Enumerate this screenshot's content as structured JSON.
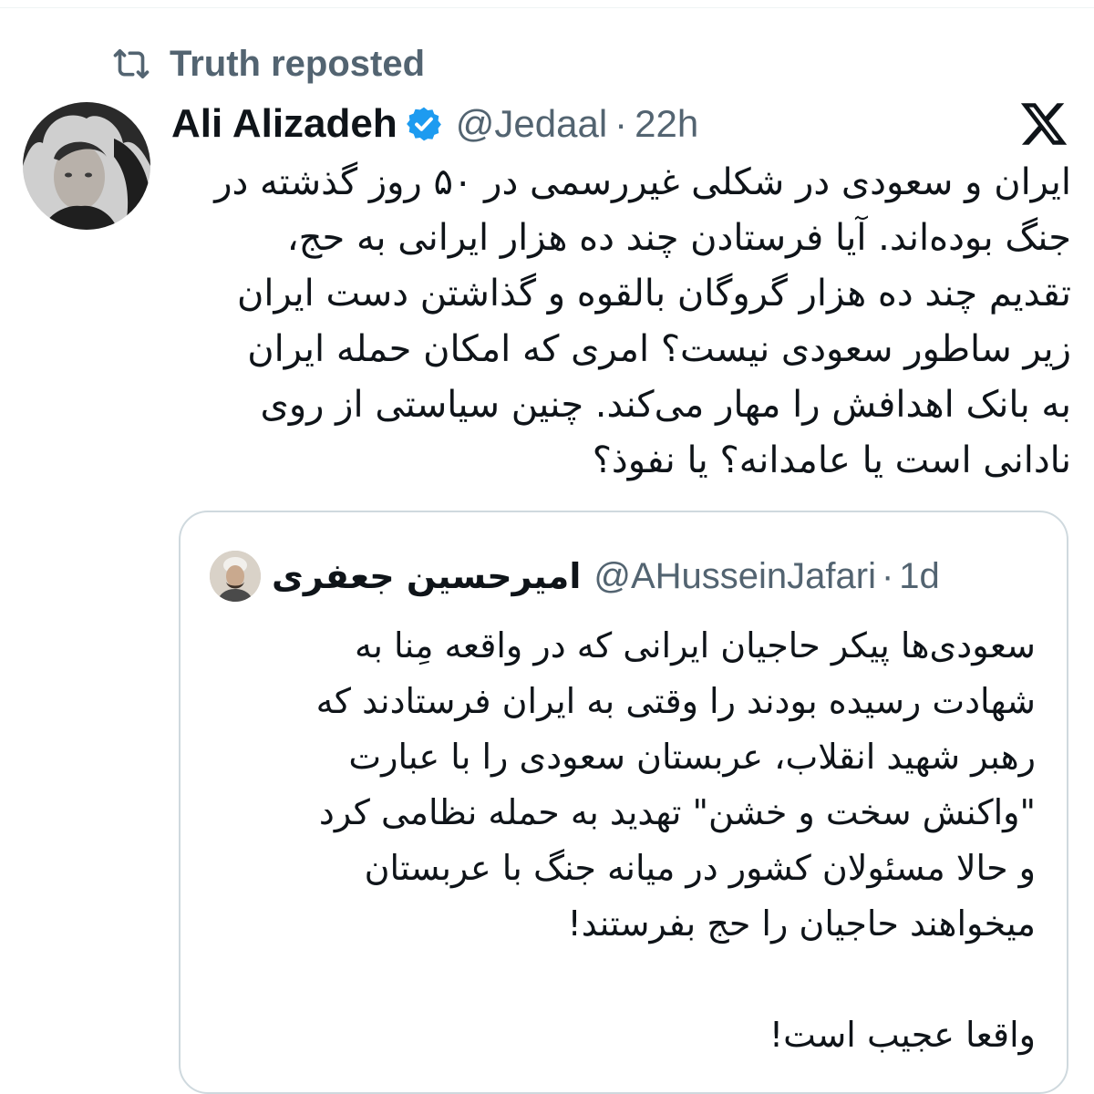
{
  "repost": {
    "label": "Truth reposted",
    "icon": "repost-icon"
  },
  "tweet": {
    "display_name": "Ali Alizadeh",
    "handle": "@Jedaal",
    "separator": "·",
    "time": "22h",
    "verified_color": "#1d9bf0",
    "lines": [
      "ایران و سعودی در شکلی غیررسمی در ۵۰ روز گذشته در",
      "جنگ بوده‌اند. آیا فرستادن چند ده هزار ایرانی به حج،",
      "تقدیم چند ده هزار گروگان بالقوه و گذاشتن دست ایران",
      "زیر ساطور سعودی نیست؟ امری که امکان حمله ایران",
      "به بانک اهدافش را مهار می‌کند. چنین سیاستی از روی",
      "نادانی است یا عامدانه؟ یا نفوذ؟"
    ]
  },
  "quote": {
    "display_name": "امیرحسین جعفری",
    "handle": "@AHusseinJafari",
    "separator": "·",
    "time": "1d",
    "lines": [
      "سعودی‌ها پیکر حاجیان ایرانی که در واقعه مِنا به",
      "شهادت رسیده بودند را وقتی به ایران فرستادند که",
      "رهبر شهید انقلاب، عربستان سعودی را با عبارت",
      "\"واکنش سخت و خشن\" تهدید به حمله نظامی کرد",
      "و حالا مسئولان کشور در میانه جنگ با عربستان",
      "میخواهند حاجیان را حج بفرستند!"
    ],
    "last_line": "واقعا عجیب است!"
  },
  "colors": {
    "text": "#0f1419",
    "secondary": "#536471",
    "border": "#cfd9de",
    "accent": "#1d9bf0"
  }
}
